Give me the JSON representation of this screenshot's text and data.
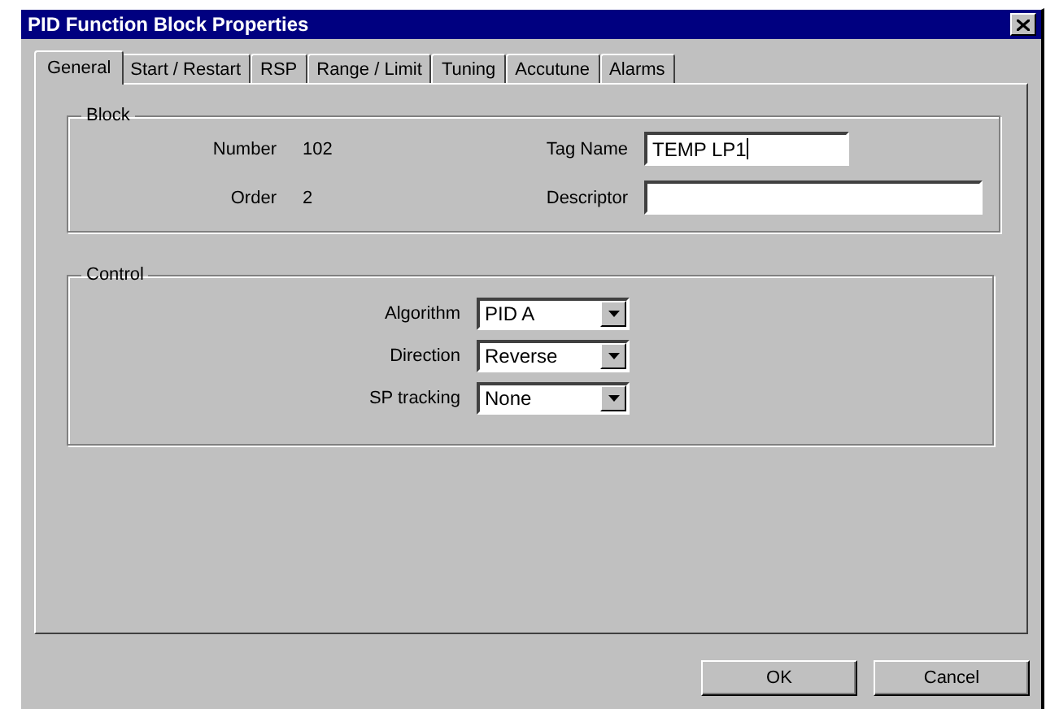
{
  "window": {
    "title": "PID Function Block Properties"
  },
  "tabs": [
    {
      "label": "General",
      "selected": true
    },
    {
      "label": "Start / Restart",
      "selected": false
    },
    {
      "label": "RSP",
      "selected": false
    },
    {
      "label": "Range / Limit",
      "selected": false
    },
    {
      "label": "Tuning",
      "selected": false
    },
    {
      "label": "Accutune",
      "selected": false
    },
    {
      "label": "Alarms",
      "selected": false
    }
  ],
  "block": {
    "title": "Block",
    "info": [
      {
        "label": "Number",
        "value": "102"
      },
      {
        "label": "Order",
        "value": "2"
      }
    ],
    "fields": [
      {
        "label": "Tag Name",
        "value": "TEMP LP1",
        "focused": true
      },
      {
        "label": "Descriptor",
        "focused": false
      }
    ]
  },
  "control": {
    "title": "Control",
    "dropdowns": [
      {
        "label": "Algorithm",
        "value": "PID A"
      },
      {
        "label": "Direction",
        "value": "Reverse"
      },
      {
        "label": "SP tracking",
        "value": "None"
      }
    ]
  },
  "buttons": [
    "OK",
    "Cancel"
  ]
}
